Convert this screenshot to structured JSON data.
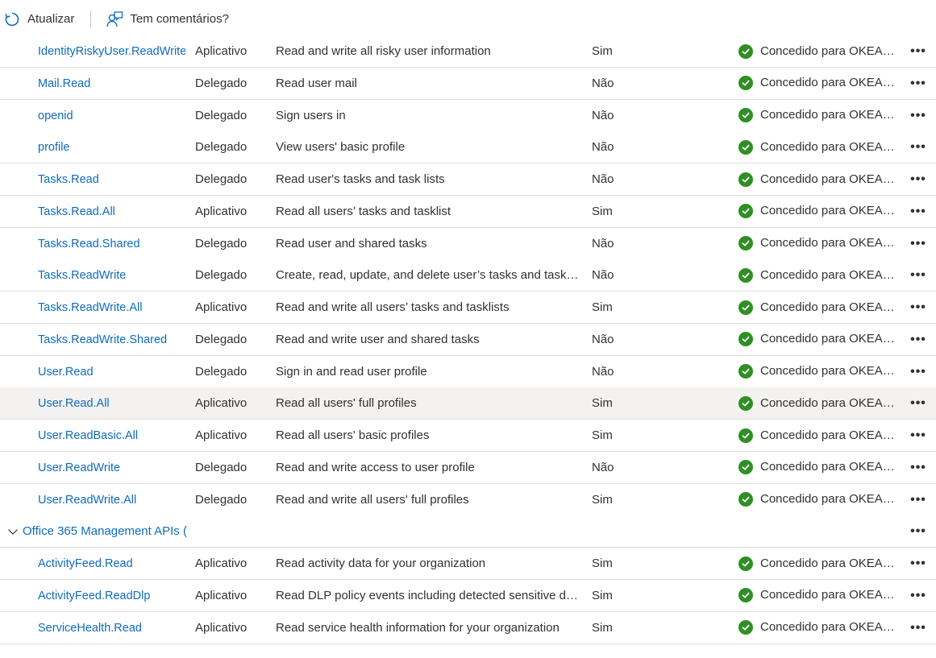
{
  "toolbar": {
    "refresh_label": "Atualizar",
    "feedback_label": "Tem comentários?"
  },
  "rows_before_group": [
    {
      "name": "IdentityRiskyUser.ReadWrite.All",
      "type": "Aplicativo",
      "description": "Read and write all risky user information",
      "admin": "Sim",
      "status": "Concedido para OKEANOS"
    },
    {
      "name": "Mail.Read",
      "type": "Delegado",
      "description": "Read user mail",
      "admin": "Não",
      "status": "Concedido para OKEANOS"
    },
    {
      "name": "openid",
      "type": "Delegado",
      "description": "Sign users in",
      "admin": "Não",
      "status": "Concedido para OKEANOS"
    },
    {
      "name": "profile",
      "type": "Delegado",
      "description": "View users' basic profile",
      "admin": "Não",
      "status": "Concedido para OKEANOS"
    },
    {
      "name": "Tasks.Read",
      "type": "Delegado",
      "description": "Read user's tasks and task lists",
      "admin": "Não",
      "status": "Concedido para OKEANOS"
    },
    {
      "name": "Tasks.Read.All",
      "type": "Aplicativo",
      "description": "Read all users’ tasks and tasklist",
      "admin": "Sim",
      "status": "Concedido para OKEANOS"
    },
    {
      "name": "Tasks.Read.Shared",
      "type": "Delegado",
      "description": "Read user and shared tasks",
      "admin": "Não",
      "status": "Concedido para OKEANOS"
    },
    {
      "name": "Tasks.ReadWrite",
      "type": "Delegado",
      "description": "Create, read, update, and delete user’s tasks and tasklists",
      "admin": "Não",
      "status": "Concedido para OKEANOS"
    },
    {
      "name": "Tasks.ReadWrite.All",
      "type": "Aplicativo",
      "description": "Read and write all users’ tasks and tasklists",
      "admin": "Sim",
      "status": "Concedido para OKEANOS"
    },
    {
      "name": "Tasks.ReadWrite.Shared",
      "type": "Delegado",
      "description": "Read and write user and shared tasks",
      "admin": "Não",
      "status": "Concedido para OKEANOS"
    },
    {
      "name": "User.Read",
      "type": "Delegado",
      "description": "Sign in and read user profile",
      "admin": "Não",
      "status": "Concedido para OKEANOS"
    },
    {
      "name": "User.Read.All",
      "type": "Aplicativo",
      "description": "Read all users' full profiles",
      "admin": "Sim",
      "status": "Concedido para OKEANOS"
    },
    {
      "name": "User.ReadBasic.All",
      "type": "Aplicativo",
      "description": "Read all users' basic profiles",
      "admin": "Sim",
      "status": "Concedido para OKEANOS"
    },
    {
      "name": "User.ReadWrite",
      "type": "Delegado",
      "description": "Read and write access to user profile",
      "admin": "Não",
      "status": "Concedido para OKEANOS"
    },
    {
      "name": "User.ReadWrite.All",
      "type": "Delegado",
      "description": "Read and write all users' full profiles",
      "admin": "Sim",
      "status": "Concedido para OKEANOS"
    }
  ],
  "group": {
    "label": "Office 365 Management APIs ("
  },
  "rows_after_group": [
    {
      "name": "ActivityFeed.Read",
      "type": "Aplicativo",
      "description": "Read activity data for your organization",
      "admin": "Sim",
      "status": "Concedido para OKEANOS"
    },
    {
      "name": "ActivityFeed.ReadDlp",
      "type": "Aplicativo",
      "description": "Read DLP policy events including detected sensitive data",
      "admin": "Sim",
      "status": "Concedido para OKEANOS"
    },
    {
      "name": "ServiceHealth.Read",
      "type": "Aplicativo",
      "description": "Read service health information for your organization",
      "admin": "Sim",
      "status": "Concedido para OKEANOS"
    }
  ],
  "selected_permission": "User.Read.All",
  "colors": {
    "link": "#0f6cbd",
    "success": "#2f8f23",
    "selected_row": "#f3f2f1"
  }
}
